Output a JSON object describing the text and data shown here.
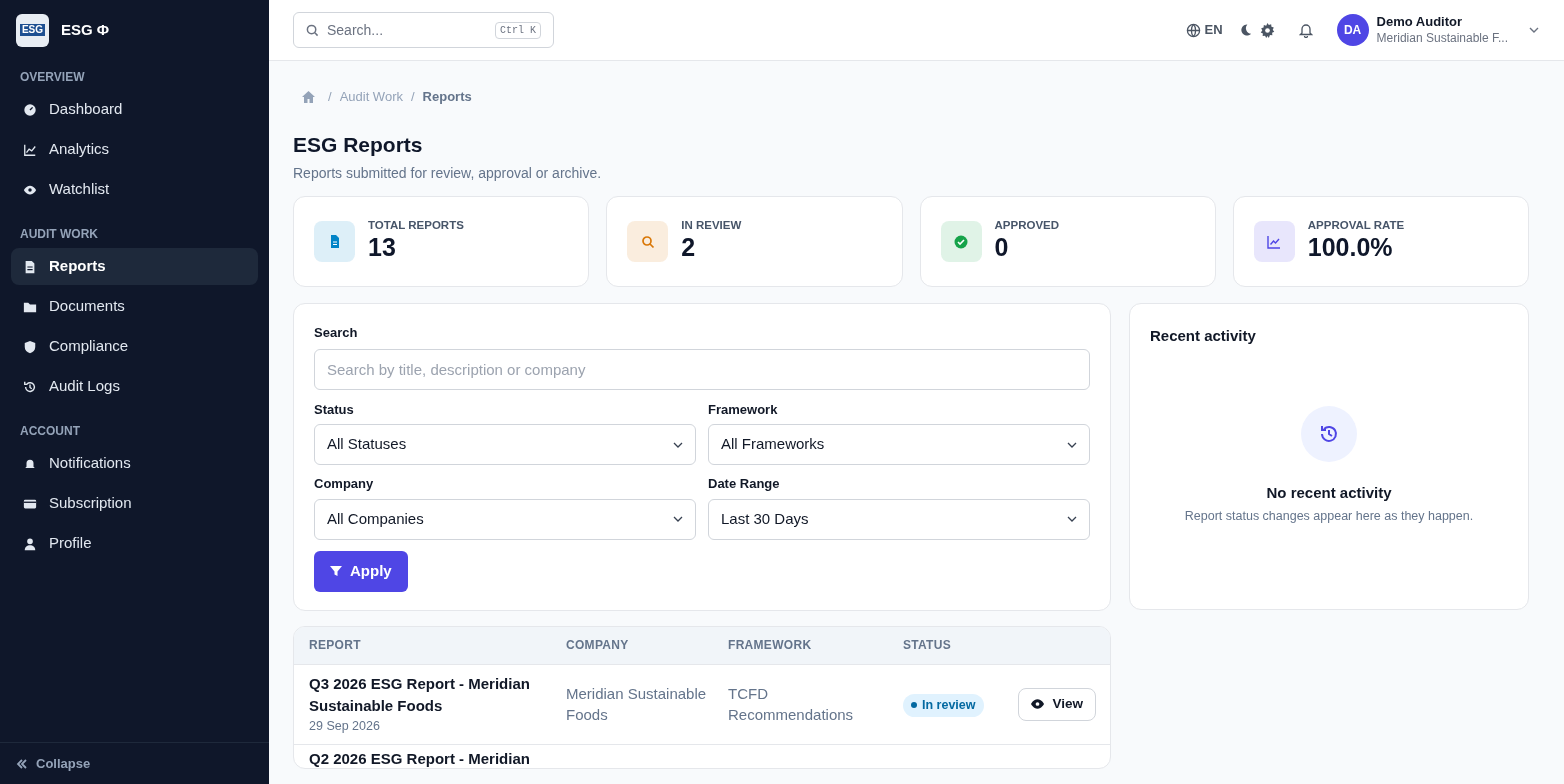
{
  "brand": {
    "name": "ESG Φ",
    "logo_text": "ESG"
  },
  "sidebar": {
    "sections": [
      {
        "title": "OVERVIEW",
        "items": [
          {
            "label": "Dashboard",
            "selected": false
          },
          {
            "label": "Analytics",
            "selected": false
          },
          {
            "label": "Watchlist",
            "selected": false
          }
        ]
      },
      {
        "title": "AUDIT WORK",
        "items": [
          {
            "label": "Reports",
            "selected": true
          },
          {
            "label": "Documents",
            "selected": false
          },
          {
            "label": "Compliance",
            "selected": false
          },
          {
            "label": "Audit Logs",
            "selected": false
          }
        ]
      },
      {
        "title": "ACCOUNT",
        "items": [
          {
            "label": "Notifications",
            "selected": false
          },
          {
            "label": "Subscription",
            "selected": false
          },
          {
            "label": "Profile",
            "selected": false
          }
        ]
      }
    ],
    "collapse": "Collapse"
  },
  "topbar": {
    "search_placeholder": "Search...",
    "shortcut": "Ctrl K",
    "language": "EN",
    "user": {
      "initials": "DA",
      "name": "Demo Auditor",
      "company": "Meridian Sustainable F..."
    }
  },
  "breadcrumb": {
    "separator": "/",
    "items": [
      "Audit Work",
      "Reports"
    ]
  },
  "page": {
    "title": "ESG Reports",
    "subtitle": "Reports submitted for review, approval or archive."
  },
  "stats": [
    {
      "label": "TOTAL REPORTS",
      "value": "13",
      "color": "#0284c7"
    },
    {
      "label": "IN REVIEW",
      "value": "2",
      "color": "#d97706"
    },
    {
      "label": "APPROVED",
      "value": "0",
      "color": "#16a34a"
    },
    {
      "label": "APPROVAL RATE",
      "value": "100.0%",
      "color": "#4f46e5"
    }
  ],
  "filters": {
    "search_label": "Search",
    "search_placeholder": "Search by title, description or company",
    "selects": [
      {
        "label": "Status",
        "value": "All Statuses"
      },
      {
        "label": "Framework",
        "value": "All Frameworks"
      },
      {
        "label": "Company",
        "value": "All Companies"
      },
      {
        "label": "Date Range",
        "value": "Last 30 Days"
      }
    ],
    "apply": "Apply"
  },
  "activity": {
    "title": "Recent activity",
    "empty_title": "No recent activity",
    "empty_text": "Report status changes appear here as they happen."
  },
  "table": {
    "columns": [
      "REPORT",
      "COMPANY",
      "FRAMEWORK",
      "STATUS"
    ],
    "rows": [
      {
        "title": "Q3 2026 ESG Report - Meridian Sustainable Foods",
        "date": "29 Sep 2026",
        "company": "Meridian Sustainable Foods",
        "framework": "TCFD Recommendations",
        "status": "In review",
        "action": "View"
      },
      {
        "title": "Q2 2026 ESG Report - Meridian"
      }
    ]
  }
}
